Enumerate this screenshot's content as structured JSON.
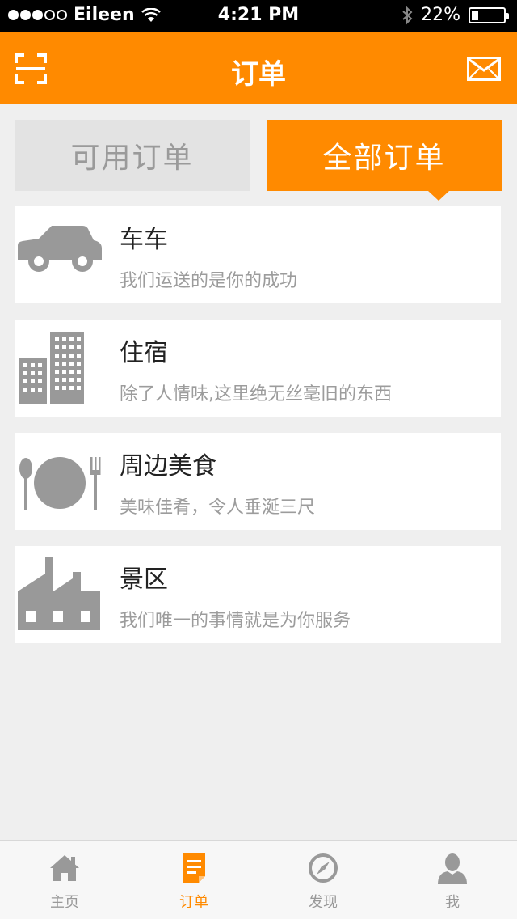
{
  "status_bar": {
    "carrier": "Eileen",
    "time": "4:21 PM",
    "battery": "22%",
    "battery_level": 0.22
  },
  "nav": {
    "title": "订单",
    "left_icon": "scan-icon",
    "right_icon": "mail-icon"
  },
  "tabs": [
    {
      "label": "可用订单",
      "active": false
    },
    {
      "label": "全部订单",
      "active": true
    }
  ],
  "items": [
    {
      "title": "车车",
      "subtitle": "我们运送的是你的成功",
      "icon": "car-icon"
    },
    {
      "title": "住宿",
      "subtitle": "除了人情味,这里绝无丝毫旧的东西",
      "icon": "building-icon"
    },
    {
      "title": "周边美食",
      "subtitle": "美味佳肴，令人垂涎三尺",
      "icon": "dining-icon"
    },
    {
      "title": "景区",
      "subtitle": "我们唯一的事情就是为你服务",
      "icon": "factory-icon"
    }
  ],
  "tab_bar": [
    {
      "label": "主页",
      "icon": "home-icon",
      "active": false
    },
    {
      "label": "订单",
      "icon": "orders-icon",
      "active": true
    },
    {
      "label": "发现",
      "icon": "compass-icon",
      "active": false
    },
    {
      "label": "我",
      "icon": "user-icon",
      "active": false
    }
  ],
  "colors": {
    "accent": "#ff8a00",
    "icon_gray": "#999999"
  }
}
